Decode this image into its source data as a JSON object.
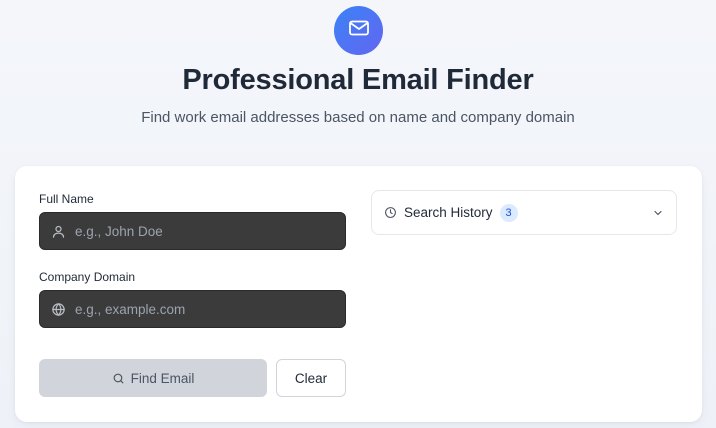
{
  "header": {
    "logo_icon": "mail-icon",
    "title": "Professional Email Finder",
    "subtitle": "Find work email addresses based on name and company domain"
  },
  "form": {
    "full_name": {
      "label": "Full Name",
      "placeholder": "e.g., John Doe",
      "value": "",
      "icon": "user-icon"
    },
    "company_domain": {
      "label": "Company Domain",
      "placeholder": "e.g., example.com",
      "value": "",
      "icon": "globe-icon"
    },
    "find_button": {
      "label": "Find Email",
      "icon": "search-icon",
      "disabled": true
    },
    "clear_button": {
      "label": "Clear"
    }
  },
  "history": {
    "title": "Search History",
    "count": "3",
    "icon": "clock-icon",
    "expanded": false
  },
  "colors": {
    "accent": "#4f6cf0",
    "input_bg": "#3b3b3b",
    "badge_bg": "#dbeafe",
    "badge_text": "#1d4ed8",
    "disabled_button": "#d1d5db"
  }
}
